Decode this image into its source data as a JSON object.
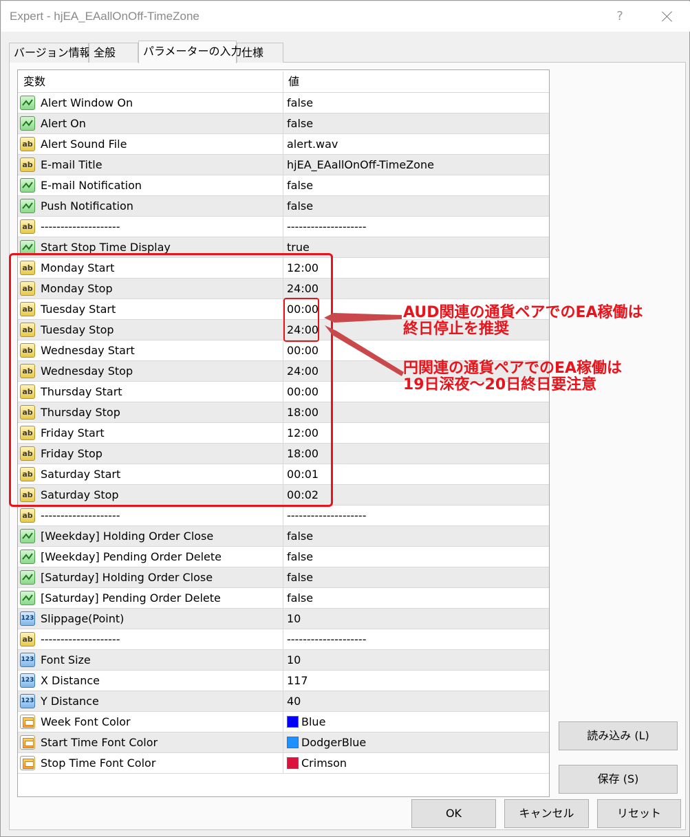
{
  "window": {
    "title": "Expert - hjEA_EAallOnOff-TimeZone",
    "help": "?"
  },
  "tabs": [
    {
      "label": "バージョン情報"
    },
    {
      "label": "全般"
    },
    {
      "label": "パラメーターの入力"
    },
    {
      "label": "仕様"
    }
  ],
  "active_tab": "パラメーターの入力",
  "grid": {
    "headers": {
      "variable": "変数",
      "value": "値"
    },
    "rows": [
      {
        "type": "bool",
        "name": "Alert Window On",
        "value": "false"
      },
      {
        "type": "bool",
        "name": "Alert On",
        "value": "false"
      },
      {
        "type": "string",
        "name": "Alert Sound File",
        "value": "alert.wav"
      },
      {
        "type": "string",
        "name": "E-mail Title",
        "value": "hjEA_EAallOnOff-TimeZone"
      },
      {
        "type": "bool",
        "name": "E-mail Notification",
        "value": "false"
      },
      {
        "type": "bool",
        "name": "Push Notification",
        "value": "false"
      },
      {
        "type": "string",
        "name": "--------------------",
        "value": "--------------------"
      },
      {
        "type": "bool",
        "name": "Start Stop Time Display",
        "value": "true"
      },
      {
        "type": "string",
        "name": "Monday Start",
        "value": "12:00"
      },
      {
        "type": "string",
        "name": "Monday Stop",
        "value": "24:00"
      },
      {
        "type": "string",
        "name": "Tuesday Start",
        "value": "00:00"
      },
      {
        "type": "string",
        "name": "Tuesday Stop",
        "value": "24:00"
      },
      {
        "type": "string",
        "name": "Wednesday Start",
        "value": "00:00"
      },
      {
        "type": "string",
        "name": "Wednesday Stop",
        "value": "24:00"
      },
      {
        "type": "string",
        "name": "Thursday Start",
        "value": "00:00"
      },
      {
        "type": "string",
        "name": "Thursday Stop",
        "value": "18:00"
      },
      {
        "type": "string",
        "name": "Friday Start",
        "value": "12:00"
      },
      {
        "type": "string",
        "name": "Friday Stop",
        "value": "18:00"
      },
      {
        "type": "string",
        "name": "Saturday Start",
        "value": "00:01"
      },
      {
        "type": "string",
        "name": "Saturday Stop",
        "value": "00:02"
      },
      {
        "type": "string",
        "name": "--------------------",
        "value": "--------------------"
      },
      {
        "type": "bool",
        "name": "[Weekday]  Holding Order Close",
        "value": "false"
      },
      {
        "type": "bool",
        "name": "[Weekday]  Pending Order Delete",
        "value": "false"
      },
      {
        "type": "bool",
        "name": "[Saturday]   Holding Order Close",
        "value": "false"
      },
      {
        "type": "bool",
        "name": "[Saturday]   Pending Order Delete",
        "value": "false"
      },
      {
        "type": "number",
        "name": "Slippage(Point)",
        "value": "10"
      },
      {
        "type": "string",
        "name": "--------------------",
        "value": "--------------------"
      },
      {
        "type": "number",
        "name": "Font Size",
        "value": "10"
      },
      {
        "type": "number",
        "name": "X Distance",
        "value": "117"
      },
      {
        "type": "number",
        "name": "Y Distance",
        "value": "40"
      },
      {
        "type": "color",
        "name": "Week Font Color",
        "value": "Blue",
        "color": "#0000ff"
      },
      {
        "type": "color",
        "name": "Start Time Font Color",
        "value": "DodgerBlue",
        "color": "#1e90ff"
      },
      {
        "type": "color",
        "name": "Stop Time Font Color",
        "value": "Crimson",
        "color": "#dc143c"
      }
    ]
  },
  "buttons": {
    "load": "読み込み (L)",
    "save": "保存 (S)",
    "ok": "OK",
    "cancel": "キャンセル",
    "reset": "リセット"
  },
  "annotations": {
    "aud_line1": "AUD関連の通貨ペアでのEA稼働は",
    "aud_line2": "終日停止を推奨",
    "jpy_line1": "円関連の通貨ペアでのEA稼働は",
    "jpy_line2": "19日深夜～20日終日要注意"
  },
  "colors": {
    "annotation_red": "#e8141c"
  }
}
